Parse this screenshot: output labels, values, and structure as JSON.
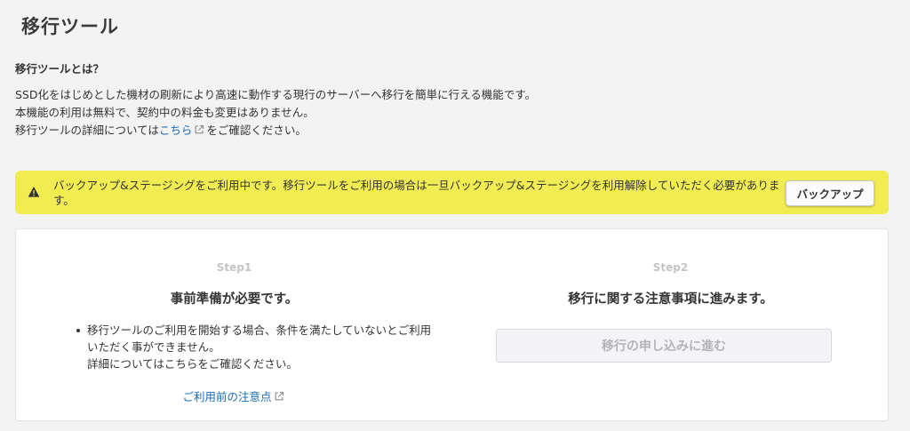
{
  "page": {
    "title": "移行ツール"
  },
  "about": {
    "heading": "移行ツールとは？",
    "line1": "SSD化をはじめとした機材の刷新により高速に動作する現行のサーバーへ移行を簡単に行える機能です。",
    "line2": "本機能の利用は無料で、契約中の料金も変更はありません。",
    "line3_prefix": "移行ツールの詳細については",
    "line3_link": "こちら",
    "line3_suffix": "をご確認ください。",
    "link_icon": "external-link-icon"
  },
  "alert": {
    "icon": "warning-icon",
    "message": "バックアップ&ステージングをご利用中です。移行ツールをご利用の場合は一旦バックアップ&ステージングを利用解除していただく必要があります。",
    "button_label": "バックアップ",
    "background_color": "#f1ec52"
  },
  "steps": {
    "step1": {
      "label": "Step1",
      "title": "事前準備が必要です。",
      "bullet_line1": "移行ツールのご利用を開始する場合、条件を満たしていないとご利用いただく事ができません。",
      "bullet_line2": "詳細についてはこちらをご確認ください。",
      "link_label": "ご利用前の注意点",
      "link_icon": "external-link-icon"
    },
    "step2": {
      "label": "Step2",
      "title": "移行に関する注意事項に進みます。",
      "button_label": "移行の申し込みに進む",
      "button_state": "disabled"
    }
  },
  "colors": {
    "link": "#1a6bb5",
    "page_background": "#f3f3f3",
    "step_label": "#c4c4c4"
  }
}
